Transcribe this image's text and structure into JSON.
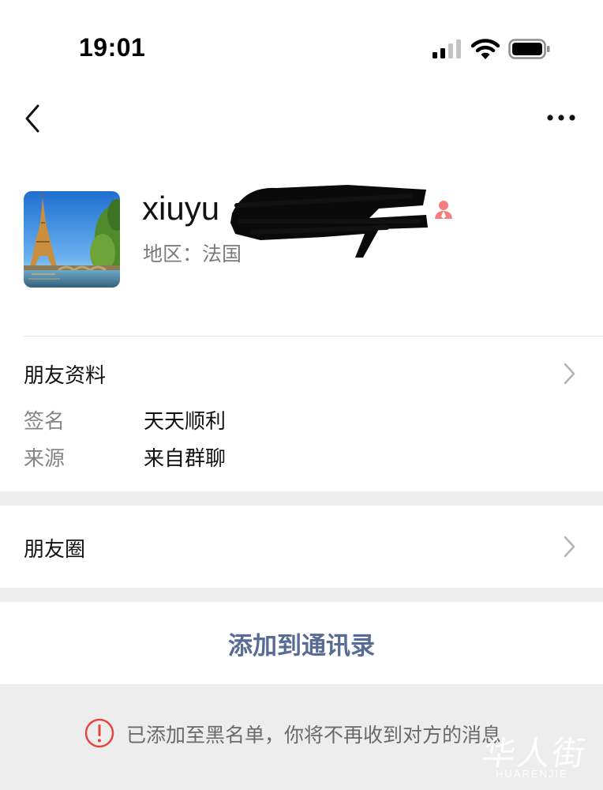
{
  "status_bar": {
    "time": "19:01",
    "icons": [
      "signal-icon",
      "wifi-icon",
      "battery-icon"
    ]
  },
  "nav": {
    "back_icon": "back-chevron-icon",
    "more_icon": "more-dots-icon"
  },
  "profile": {
    "name_visible": "xiuyu",
    "name_redacted": true,
    "region": "地区：法国",
    "gender_icon": "female-icon",
    "avatar": "eiffel-tower-photo"
  },
  "friend_info": {
    "title": "朋友资料",
    "signature_label": "签名",
    "signature_value": "天天顺利",
    "source_label": "来源",
    "source_value": "来自群聊"
  },
  "moments": {
    "title": "朋友圈"
  },
  "add_contact": {
    "label": "添加到通讯录"
  },
  "blacklist_notice": {
    "icon": "alert-circle-icon",
    "text": "已添加至黑名单，你将不再收到对方的消息"
  },
  "watermark": {
    "cn": "华人街",
    "en": "HUARENJIE"
  },
  "colors": {
    "link": "#576b95",
    "alert": "#e64340",
    "gender": "#f37e7d",
    "bg": "#ededed"
  }
}
